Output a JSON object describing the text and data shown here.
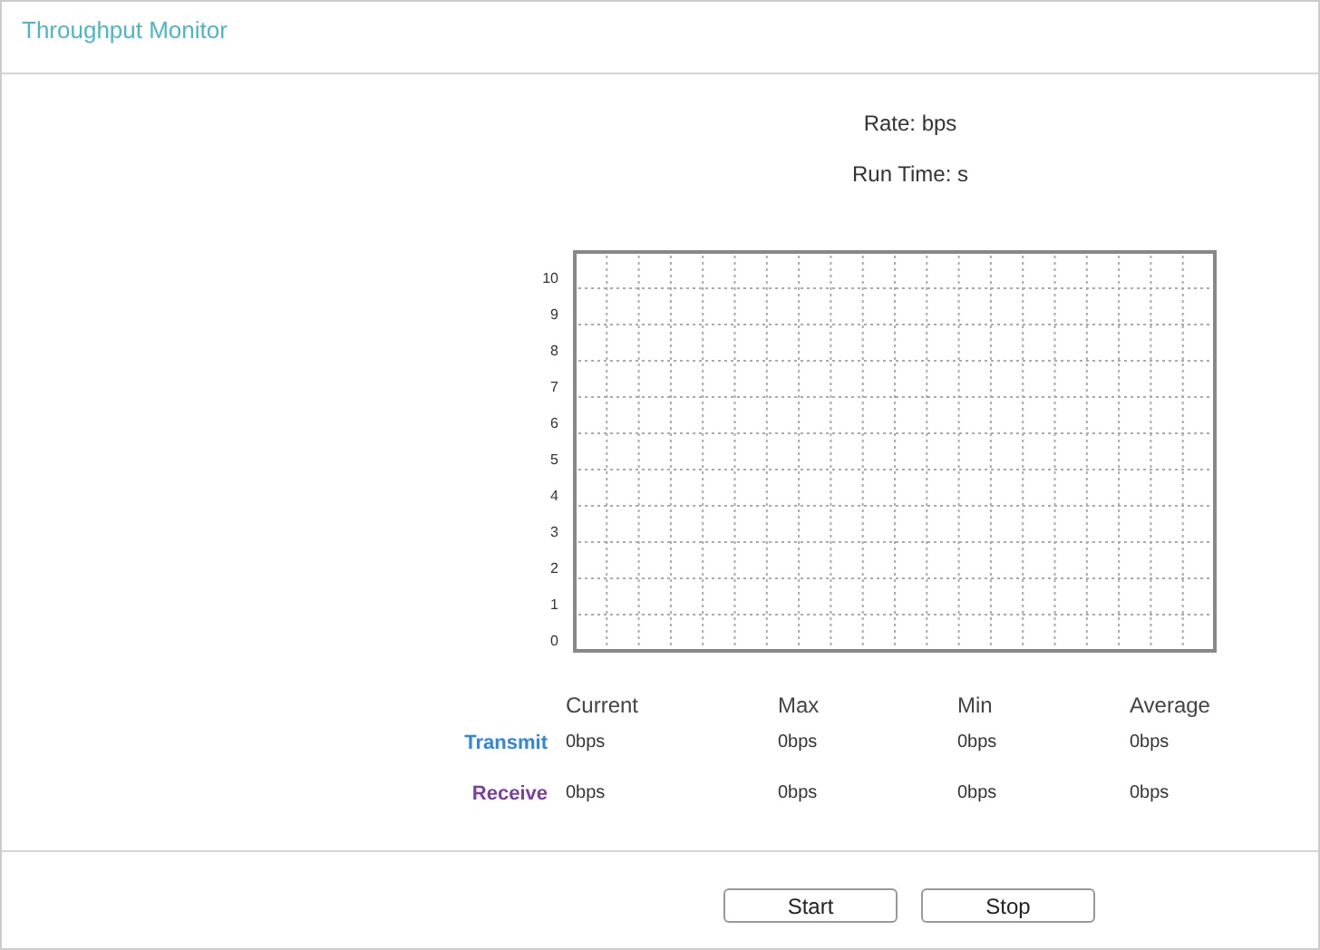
{
  "window": {
    "title": "Throughput Monitor"
  },
  "rate": "Rate: bps",
  "run_time": "Run Time: s",
  "chart": {
    "y_axis_labels": [
      "10",
      "9",
      "8",
      "7",
      "6",
      "5",
      "4",
      "3",
      "2",
      "1",
      "0"
    ]
  },
  "stats": {
    "columns": [
      "Current",
      "Max",
      "Min",
      "Average"
    ],
    "rows": [
      {
        "name": "Transmit",
        "color": "#2e86de",
        "values": [
          "0bps",
          "0bps",
          "0bps",
          "0bps"
        ]
      },
      {
        "name": "Receive",
        "color": "#7b3fa0",
        "values": [
          "0bps",
          "0bps",
          "0bps",
          "0bps"
        ]
      }
    ]
  },
  "buttons": [
    "Start",
    "Stop"
  ]
}
